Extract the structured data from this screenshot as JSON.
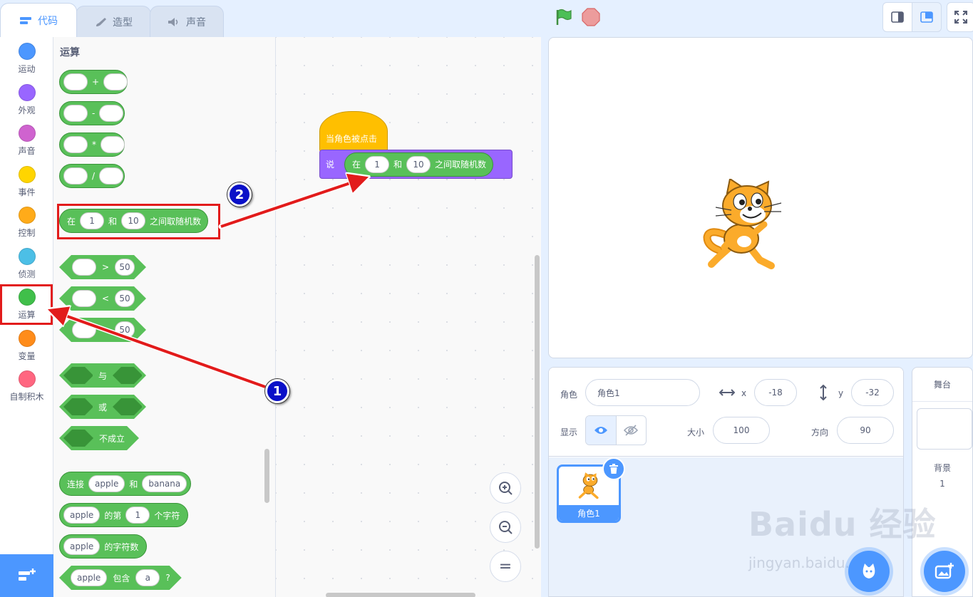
{
  "tabs": [
    {
      "label": "代码",
      "icon": "code-icon"
    },
    {
      "label": "造型",
      "icon": "brush-icon"
    },
    {
      "label": "声音",
      "icon": "speaker-icon"
    }
  ],
  "categories": [
    {
      "label": "运动",
      "color": "#4c97ff"
    },
    {
      "label": "外观",
      "color": "#9966ff"
    },
    {
      "label": "声音",
      "color": "#cf63cf"
    },
    {
      "label": "事件",
      "color": "#ffd500"
    },
    {
      "label": "控制",
      "color": "#ffab19"
    },
    {
      "label": "侦测",
      "color": "#4cbfe6"
    },
    {
      "label": "运算",
      "color": "#40bf4a"
    },
    {
      "label": "变量",
      "color": "#ff8c1a"
    },
    {
      "label": "自制积木",
      "color": "#ff6680"
    }
  ],
  "palette": {
    "title": "运算",
    "ops": [
      "+",
      "-",
      "*",
      "/"
    ],
    "random": {
      "prefix": "在",
      "from": "1",
      "and": "和",
      "to": "10",
      "suffix": "之间取随机数"
    },
    "compare": [
      {
        "op": ">",
        "value": "50"
      },
      {
        "op": "<",
        "value": "50"
      },
      {
        "op": "=",
        "value": "50"
      }
    ],
    "logic": [
      "与",
      "或",
      "不成立"
    ],
    "join": {
      "label": "连接",
      "a": "apple",
      "and": "和",
      "b": "banana"
    },
    "letter": {
      "a": "apple",
      "mid": "的第",
      "n": "1",
      "suffix": "个字符"
    },
    "length": {
      "a": "apple",
      "suffix": "的字符数"
    },
    "contains": {
      "a": "apple",
      "mid": "包含",
      "b": "a",
      "suffix": "?"
    }
  },
  "script": {
    "hat": "当角色被点击",
    "say": "说",
    "random": {
      "prefix": "在",
      "from": "1",
      "and": "和",
      "to": "10",
      "suffix": "之间取随机数"
    }
  },
  "zoom": {
    "in": "+",
    "out": "−",
    "reset": "="
  },
  "sprite_info": {
    "sprite_label": "角色",
    "sprite_name": "角色1",
    "x_label": "x",
    "x": "-18",
    "y_label": "y",
    "y": "-32",
    "show_label": "显示",
    "size_label": "大小",
    "size": "100",
    "direction_label": "方向",
    "direction": "90"
  },
  "sprite_list": [
    {
      "name": "角色1"
    }
  ],
  "stage_panel": {
    "title": "舞台",
    "backdrop_label": "背景",
    "backdrop_count": "1"
  },
  "annotations": {
    "badge1": "1",
    "badge2": "2"
  },
  "watermark": {
    "main": "Baidu 经验",
    "sub": "jingyan.baidu.com"
  }
}
